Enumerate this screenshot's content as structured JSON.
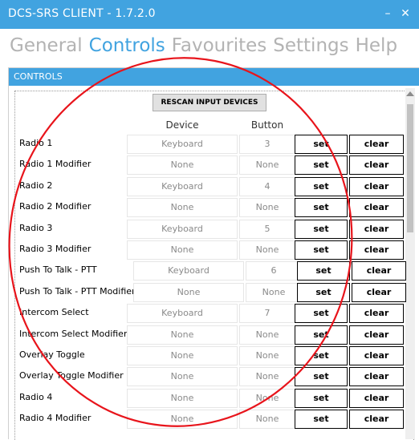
{
  "window": {
    "title": "DCS-SRS CLIENT - 1.7.2.0",
    "minimize_glyph": "–",
    "close_glyph": "✕"
  },
  "menu": {
    "items": [
      {
        "label": "General",
        "active": false
      },
      {
        "label": "Controls",
        "active": true
      },
      {
        "label": "Favourites",
        "active": false
      },
      {
        "label": "Settings",
        "active": false
      },
      {
        "label": "Help",
        "active": false
      }
    ]
  },
  "panel": {
    "title": "CONTROLS",
    "rescan_label": "RESCAN INPUT DEVICES",
    "device_header": "Device",
    "button_header": "Button"
  },
  "controls": [
    {
      "name": "Radio 1",
      "device": "Keyboard",
      "button": "3",
      "set": "set",
      "clear": "clear"
    },
    {
      "name": "Radio 1 Modifier",
      "device": "None",
      "button": "None",
      "set": "set",
      "clear": "clear"
    },
    {
      "name": "Radio 2",
      "device": "Keyboard",
      "button": "4",
      "set": "set",
      "clear": "clear"
    },
    {
      "name": "Radio 2 Modifier",
      "device": "None",
      "button": "None",
      "set": "set",
      "clear": "clear"
    },
    {
      "name": "Radio 3",
      "device": "Keyboard",
      "button": "5",
      "set": "set",
      "clear": "clear"
    },
    {
      "name": "Radio 3 Modifier",
      "device": "None",
      "button": "None",
      "set": "set",
      "clear": "clear"
    },
    {
      "name": "Push To Talk - PTT",
      "device": "Keyboard",
      "button": "6",
      "set": "set",
      "clear": "clear"
    },
    {
      "name": "Push To Talk - PTT Modifier",
      "device": "None",
      "button": "None",
      "set": "set",
      "clear": "clear"
    },
    {
      "name": "Intercom Select",
      "device": "Keyboard",
      "button": "7",
      "set": "set",
      "clear": "clear"
    },
    {
      "name": "Intercom Select Modifier",
      "device": "None",
      "button": "None",
      "set": "set",
      "clear": "clear"
    },
    {
      "name": "Overlay Toggle",
      "device": "None",
      "button": "None",
      "set": "set",
      "clear": "clear"
    },
    {
      "name": "Overlay Toggle Modifier",
      "device": "None",
      "button": "None",
      "set": "set",
      "clear": "clear"
    },
    {
      "name": "Radio 4",
      "device": "None",
      "button": "None",
      "set": "set",
      "clear": "clear"
    },
    {
      "name": "Radio 4 Modifier",
      "device": "None",
      "button": "None",
      "set": "set",
      "clear": "clear"
    }
  ],
  "colors": {
    "accent": "#41a3e0",
    "annotation_circle": "#e8141b"
  }
}
